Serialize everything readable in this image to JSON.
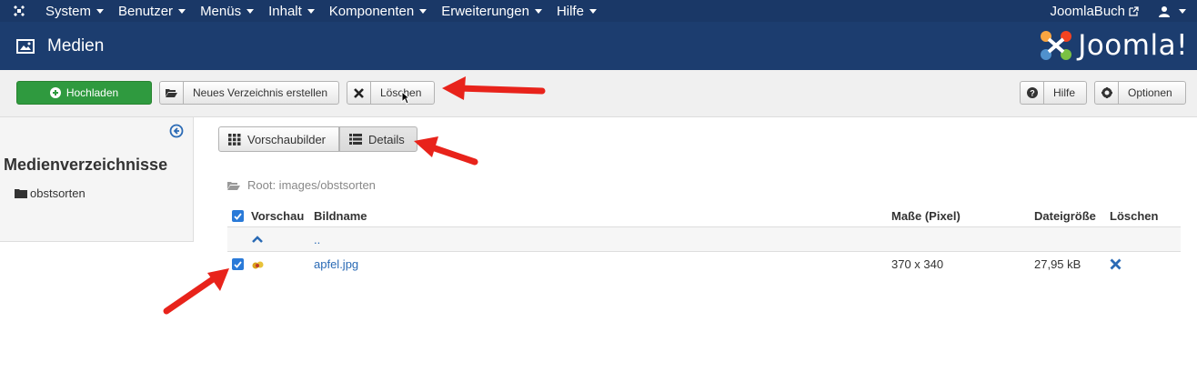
{
  "topnav": {
    "menu": [
      {
        "label": "System"
      },
      {
        "label": "Benutzer"
      },
      {
        "label": "Menüs"
      },
      {
        "label": "Inhalt"
      },
      {
        "label": "Komponenten"
      },
      {
        "label": "Erweiterungen"
      },
      {
        "label": "Hilfe"
      }
    ],
    "site_name": "JoomlaBuch"
  },
  "header": {
    "title": "Medien",
    "brand": "Joomla!"
  },
  "toolbar": {
    "upload": "Hochladen",
    "new_dir": "Neues Verzeichnis erstellen",
    "delete": "Löschen",
    "help": "Hilfe",
    "options": "Optionen"
  },
  "sidebar": {
    "heading": "Medienverzeichnisse",
    "folders": [
      {
        "label": "obstsorten"
      }
    ]
  },
  "view": {
    "thumbnails": "Vorschaubilder",
    "details": "Details"
  },
  "breadcrumb": "Root: images/obstsorten",
  "table": {
    "headers": {
      "preview": "Vorschau",
      "name": "Bildname",
      "dimensions": "Maße (Pixel)",
      "filesize": "Dateigröße",
      "delete": "Löschen"
    },
    "up_row": {
      "name": ".."
    },
    "rows": [
      {
        "name": "apfel.jpg",
        "dimensions": "370 x 340",
        "filesize": "27,95 kB",
        "checked": true
      }
    ]
  },
  "colors": {
    "nav": "#1a3867",
    "header": "#1c3d6f",
    "upload_green": "#2f9a3f",
    "link": "#2a6ab5",
    "annotation_red": "#e8231b"
  }
}
